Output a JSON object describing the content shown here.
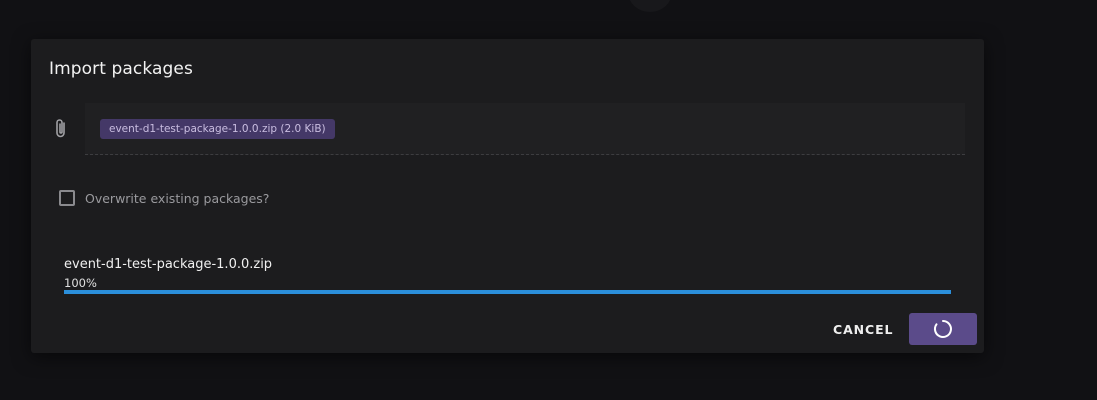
{
  "dialog": {
    "title": "Import packages",
    "selected_file_chip": "event-d1-test-package-1.0.0.zip (2.0 KiB)",
    "overwrite_label": "Overwrite existing packages?",
    "overwrite_checked": false,
    "upload": {
      "filename": "event-d1-test-package-1.0.0.zip",
      "progress_label": "100%",
      "progress": 1.0
    },
    "cancel_label": "CANCEL",
    "submit_state": "loading"
  },
  "colors": {
    "accent": "#5b4b8a",
    "progress": "#2b8fdb",
    "chip_bg": "#443867"
  },
  "icons": [
    "paperclip-icon",
    "checkbox-icon",
    "spinner-icon"
  ]
}
